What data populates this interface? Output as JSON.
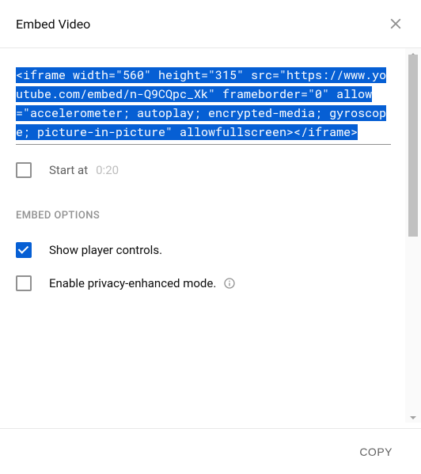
{
  "header": {
    "title": "Embed Video"
  },
  "embed": {
    "code": "<iframe width=\"560\" height=\"315\" src=\"https://www.youtube.com/embed/n-Q9CQpc_Xk\" frameborder=\"0\" allow=\"accelerometer; autoplay; encrypted-media; gyroscope; picture-in-picture\" allowfullscreen></iframe>"
  },
  "startAt": {
    "label": "Start at",
    "value": "0:20",
    "checked": false
  },
  "optionsHeading": "EMBED OPTIONS",
  "options": {
    "playerControls": {
      "label": "Show player controls.",
      "checked": true
    },
    "privacy": {
      "label": "Enable privacy-enhanced mode.",
      "checked": false
    }
  },
  "footer": {
    "copy": "COPY"
  }
}
